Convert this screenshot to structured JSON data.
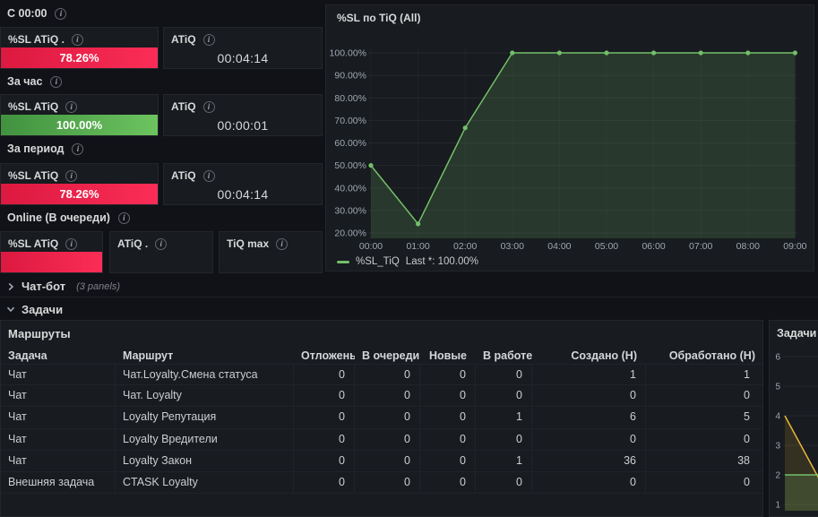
{
  "theme": {
    "bg": "#111217",
    "panel_bg": "#181b1f",
    "border": "#25262b",
    "text": "#d8d9da",
    "text_muted": "#9fa7b3",
    "red_dark": "#dc1940",
    "red_bright": "#fb2d57",
    "green_dark": "#41913f",
    "green_bright": "#6cc45f",
    "line_green": "#73bf69",
    "line_yellow": "#eab839",
    "grid_line": "rgba(204,204,220,0.07)"
  },
  "left": {
    "sections": [
      {
        "label": "С 00:00",
        "panels": [
          {
            "title": "%SL ATiQ .",
            "kind": "bar",
            "color": "red",
            "value": "78.26%"
          },
          {
            "title": "ATiQ",
            "kind": "stat",
            "value": "00:04:14"
          }
        ]
      },
      {
        "label": "За час",
        "panels": [
          {
            "title": "%SL ATiQ",
            "kind": "bar",
            "color": "green",
            "value": "100.00%"
          },
          {
            "title": "ATiQ",
            "kind": "stat",
            "value": "00:00:01"
          }
        ]
      },
      {
        "label": "За период",
        "panels": [
          {
            "title": "%SL ATiQ",
            "kind": "bar",
            "color": "red",
            "value": "78.26%"
          },
          {
            "title": "ATiQ",
            "kind": "stat",
            "value": "00:04:14"
          }
        ]
      },
      {
        "label": "Online (В очереди)",
        "panels": [
          {
            "title": "%SL ATiQ",
            "kind": "bar",
            "color": "red",
            "value": ""
          },
          {
            "title": "ATiQ .",
            "kind": "stat",
            "value": ""
          },
          {
            "title": "TiQ max",
            "kind": "stat",
            "value": ""
          }
        ]
      }
    ]
  },
  "rows": {
    "chatbot": {
      "label": "Чат-бот",
      "meta": "(3 panels)",
      "collapsed": true
    },
    "tasks": {
      "label": "Задачи",
      "collapsed": false
    }
  },
  "chart_data": [
    {
      "type": "line",
      "title": "%SL по TiQ (All)",
      "x": [
        "00:00",
        "01:00",
        "02:00",
        "03:00",
        "04:00",
        "05:00",
        "06:00",
        "07:00",
        "08:00",
        "09:00"
      ],
      "series": [
        {
          "name": "%SL_TiQ",
          "color": "#73bf69",
          "fill": true,
          "values": [
            50,
            24,
            66.7,
            100,
            100,
            100,
            100,
            100,
            100,
            100
          ]
        }
      ],
      "y_ticks": [
        100,
        90,
        80,
        70,
        60,
        50,
        40,
        30,
        20
      ],
      "y_tick_labels": [
        "100.00%",
        "90.00%",
        "80.00%",
        "70.00%",
        "60.00%",
        "50.00%",
        "40.00%",
        "30.00%",
        "20.00%"
      ],
      "ylim": [
        16,
        104
      ],
      "grid": true,
      "legend_position": "bottom",
      "legend_stat": "Last *: 100.00%"
    },
    {
      "type": "line",
      "title": "Задачи (All",
      "y_ticks": [
        6,
        5,
        4,
        3,
        2,
        1
      ],
      "note": "panel clipped at right screen edge",
      "series": [
        {
          "name": "series-yellow",
          "color": "#eab839",
          "fill": true,
          "visible_values": [
            4,
            1.6
          ]
        },
        {
          "name": "series-green",
          "color": "#73bf69",
          "fill": true,
          "visible_values": [
            2,
            2
          ]
        }
      ]
    }
  ],
  "routes_table": {
    "title": "Маршруты",
    "columns": [
      "Задача",
      "Маршрут",
      "Отложены",
      "В очереди",
      "Новые",
      "В работе",
      "Создано (Н)",
      "Обработано (Н)"
    ],
    "sorted_by": "В очереди",
    "sort_icon": "↓",
    "rows": [
      [
        "Чат",
        "Чат.Loyalty.Смена статуса",
        "0",
        "0",
        "0",
        "0",
        "1",
        "1"
      ],
      [
        "Чат",
        "Чат. Loyalty",
        "0",
        "0",
        "0",
        "0",
        "0",
        "0"
      ],
      [
        "Чат",
        "Loyalty Репутация",
        "0",
        "0",
        "0",
        "1",
        "6",
        "5"
      ],
      [
        "Чат",
        "Loyalty Вредители",
        "0",
        "0",
        "0",
        "0",
        "0",
        "0"
      ],
      [
        "Чат",
        "Loyalty Закон",
        "0",
        "0",
        "0",
        "1",
        "36",
        "38"
      ],
      [
        "Внешняя задача",
        "CTASK Loyalty",
        "0",
        "0",
        "0",
        "0",
        "0",
        "0"
      ]
    ]
  }
}
